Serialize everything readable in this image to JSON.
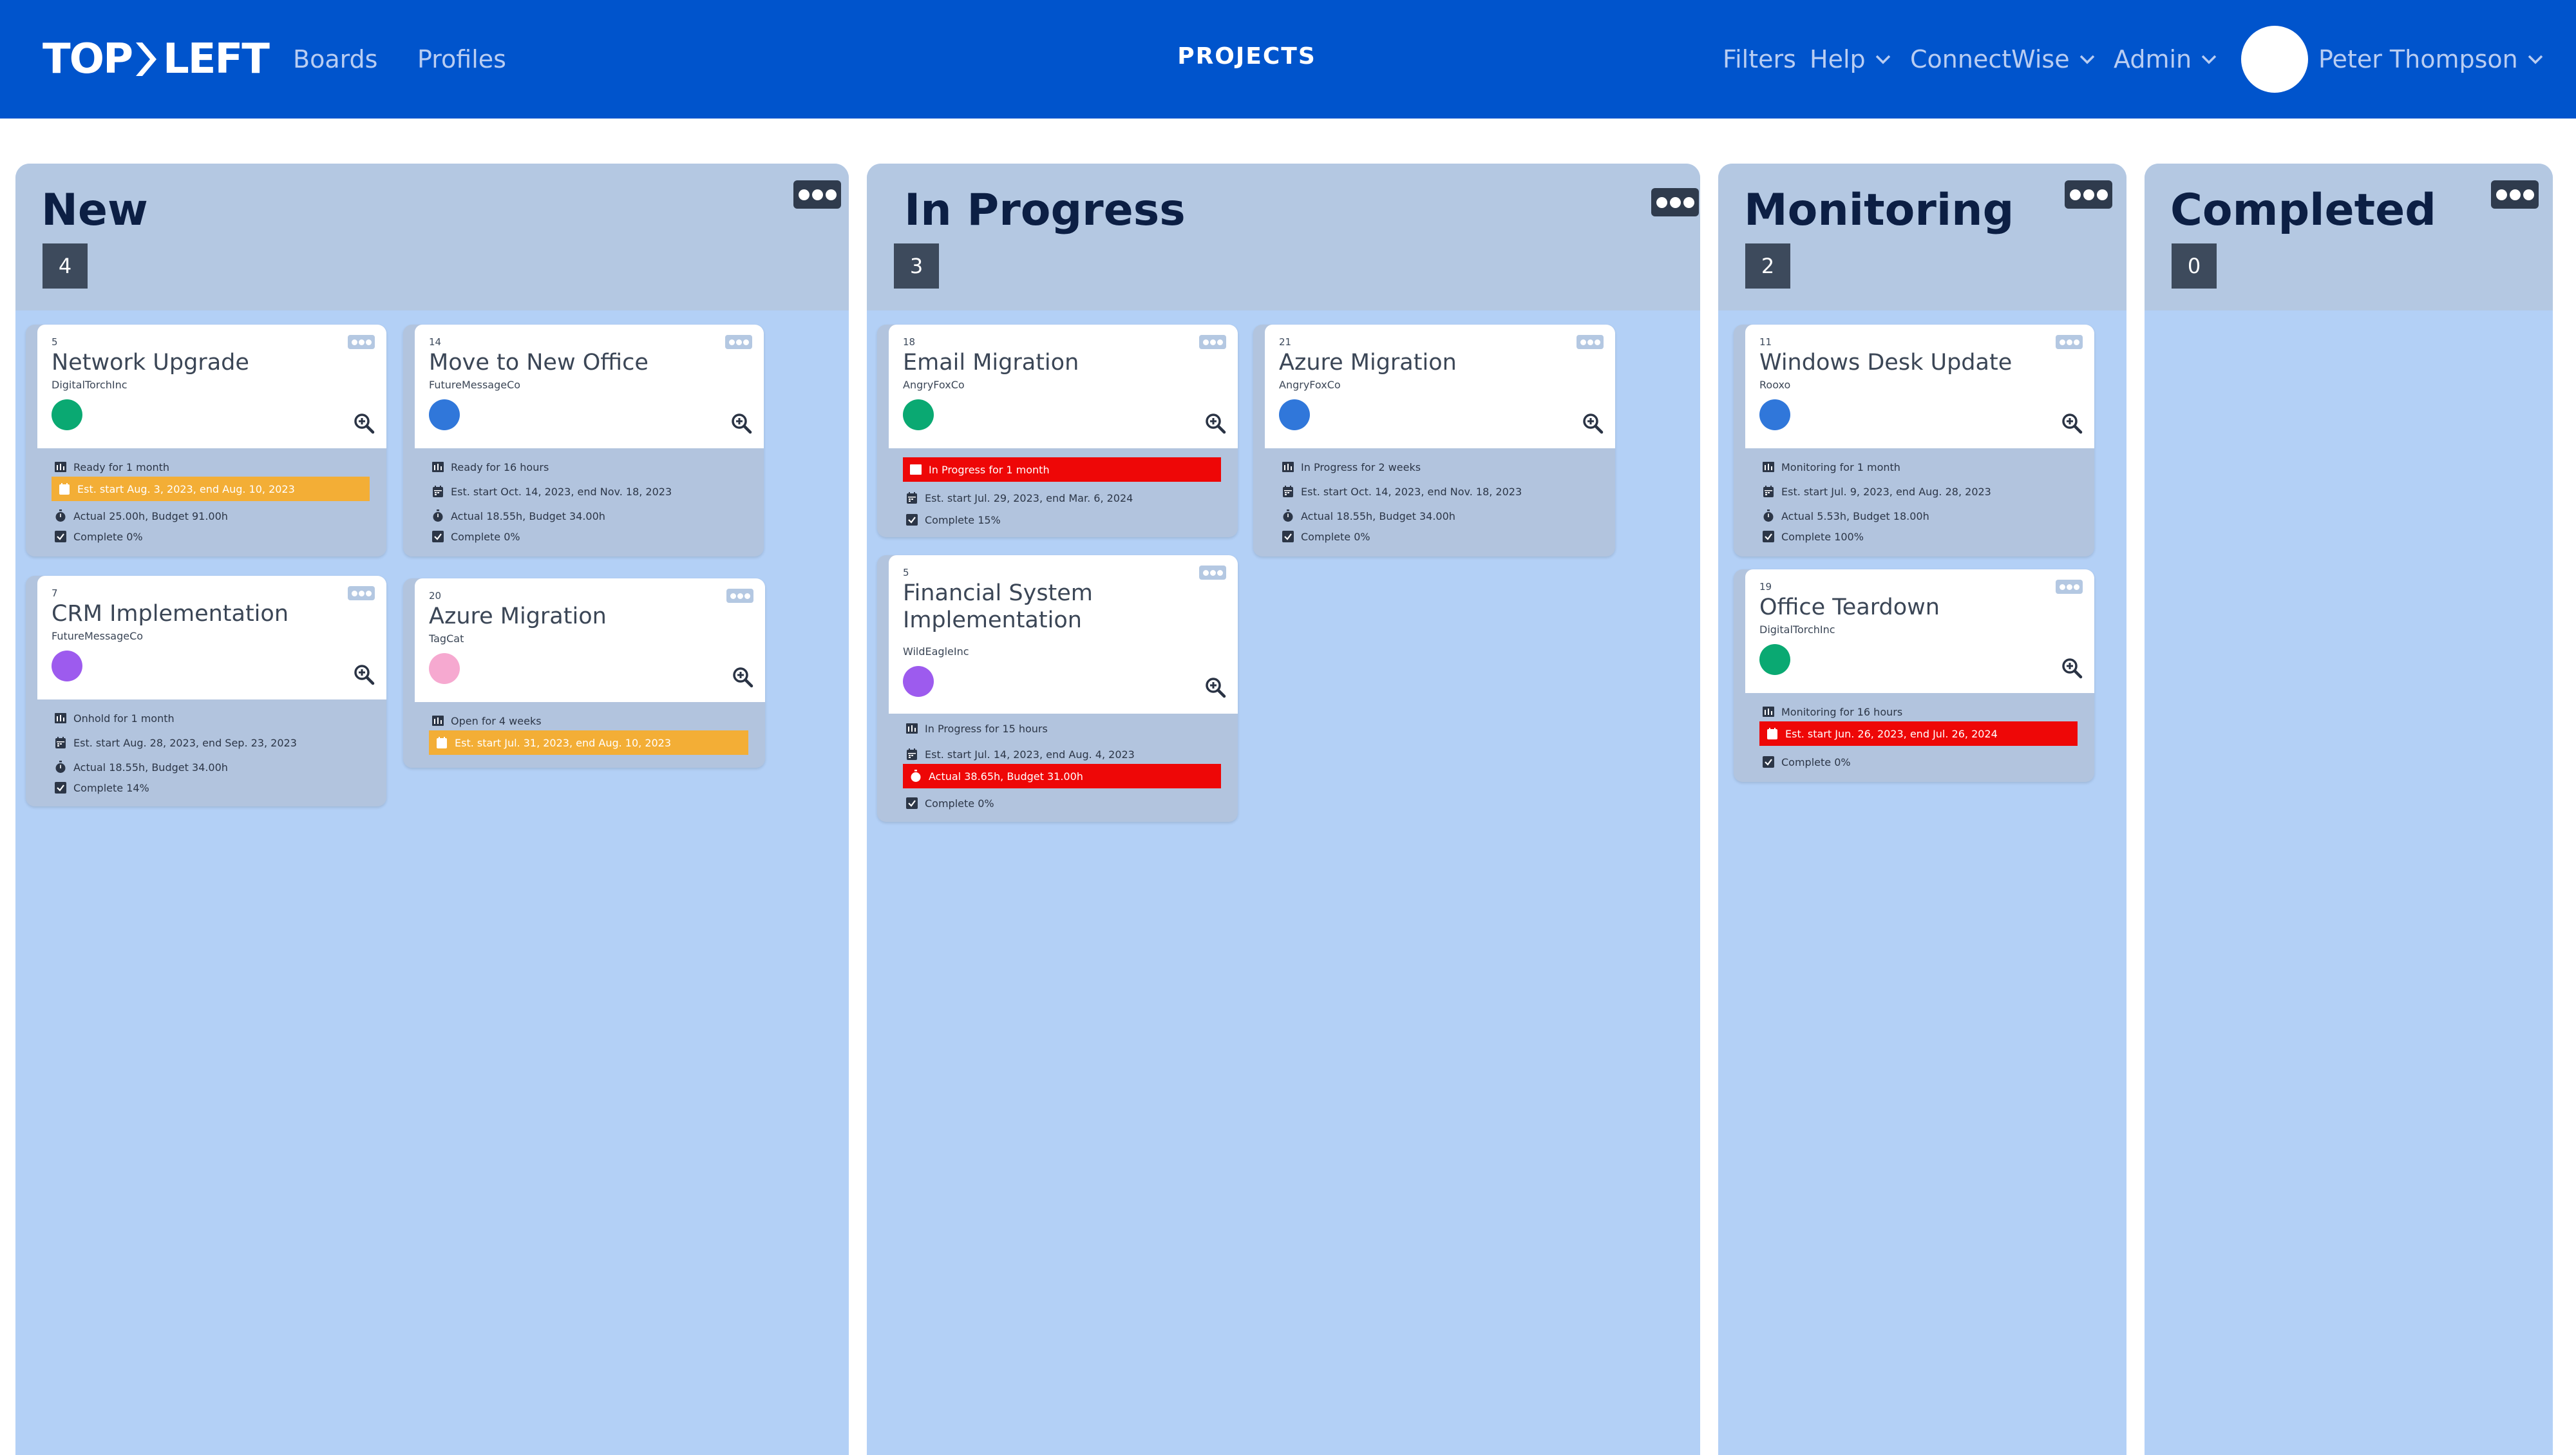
{
  "header": {
    "logo": "TOPLEFT",
    "logo_left": "TOP",
    "logo_right": "LEFT",
    "nav": [
      "Boards",
      "Profiles"
    ],
    "page_title": "PROJECTS",
    "menus": [
      "Filters",
      "Help",
      "ConnectWise",
      "Admin"
    ],
    "user_name": "Peter Thompson"
  },
  "colors": {
    "header": "#0054cc",
    "column": "#b3d0f6",
    "column_header": "#b4c8e2",
    "warning": "#f3ae36",
    "danger": "#ee0707",
    "dot_green": "#0aa972",
    "dot_blue": "#3077da",
    "dot_purple": "#9d5bee",
    "dot_pink": "#f6a9d0"
  },
  "columns": [
    {
      "title": "New",
      "count": "4",
      "cards": [
        {
          "num": "5",
          "title": "Network Upgrade",
          "client": "DigitalTorchInc",
          "dot": "dot_green",
          "status": "Ready for 1 month",
          "dates": "Est. start Aug. 3, 2023, end Aug. 10, 2023",
          "hours": "Actual 25.00h, Budget 91.00h",
          "complete": "Complete 0%"
        },
        {
          "num": "14",
          "title": "Move to New Office",
          "client": "FutureMessageCo",
          "dot": "dot_blue",
          "status": "Ready for 16 hours",
          "dates": "Est. start Oct. 14, 2023, end Nov. 18, 2023",
          "hours": "Actual 18.55h, Budget 34.00h",
          "complete": "Complete 0%"
        },
        {
          "num": "7",
          "title": "CRM Implementation",
          "client": "FutureMessageCo",
          "dot": "dot_purple",
          "status": "Onhold for 1 month",
          "dates": "Est. start Aug. 28, 2023, end Sep. 23, 2023",
          "hours": "Actual 18.55h, Budget 34.00h",
          "complete": "Complete 14%"
        },
        {
          "num": "20",
          "title": "Azure Migration",
          "client": "TagCat",
          "dot": "dot_pink",
          "status": "Open for 4 weeks",
          "dates": "Est. start Jul. 31, 2023, end Aug. 10, 2023"
        }
      ]
    },
    {
      "title": "In Progress",
      "count": "3",
      "cards": [
        {
          "num": "18",
          "title": "Email Migration",
          "client": "AngryFoxCo",
          "dot": "dot_green",
          "status": "In Progress for 1 month",
          "dates": "Est. start Jul. 29, 2023, end Mar. 6, 2024",
          "complete": "Complete 15%"
        },
        {
          "num": "21",
          "title": "Azure Migration",
          "client": "AngryFoxCo",
          "dot": "dot_blue",
          "status": "In Progress for 2 weeks",
          "dates": "Est. start Oct. 14, 2023, end Nov. 18, 2023",
          "hours": "Actual 18.55h, Budget 34.00h",
          "complete": "Complete 0%"
        },
        {
          "num": "5",
          "title": "Financial System Implementation",
          "client": "WildEagleInc",
          "dot": "dot_purple",
          "status": "In Progress for 15 hours",
          "dates": "Est. start Jul. 14, 2023, end Aug. 4, 2023",
          "hours": "Actual 38.65h, Budget 31.00h",
          "complete": "Complete 0%"
        }
      ]
    },
    {
      "title": "Monitoring",
      "count": "2",
      "cards": [
        {
          "num": "11",
          "title": "Windows Desk Update",
          "client": "Rooxo",
          "dot": "dot_blue",
          "status": "Monitoring for 1 month",
          "dates": "Est. start Jul. 9, 2023, end Aug. 28, 2023",
          "hours": "Actual 5.53h, Budget 18.00h",
          "complete": "Complete 100%"
        },
        {
          "num": "19",
          "title": "Office Teardown",
          "client": "DigitalTorchInc",
          "dot": "dot_green",
          "status": "Monitoring for 16 hours",
          "dates": "Est. start Jun. 26, 2023, end Jul. 26, 2024",
          "complete": "Complete 0%"
        }
      ]
    },
    {
      "title": "Completed",
      "count": "0",
      "cards": []
    }
  ]
}
